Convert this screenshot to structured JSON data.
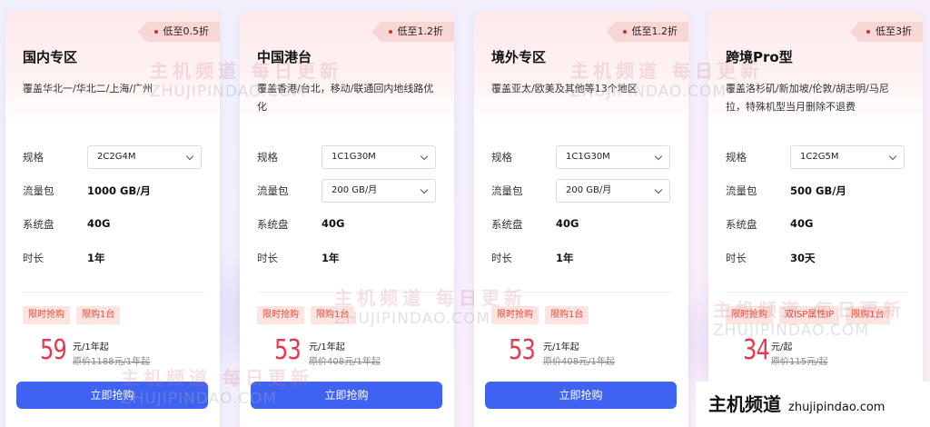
{
  "cards": [
    {
      "discount": "低至0.5折",
      "title": "国内专区",
      "desc": "覆盖华北一/华北二/上海/广州",
      "spec_label": "规格",
      "spec_value": "2C2G4M",
      "traffic_label": "流量包",
      "traffic_value": "1000 GB/月",
      "disk_label": "系统盘",
      "disk_value": "40G",
      "duration_label": "时长",
      "duration_value": "1年",
      "tags": [
        "限时抢购",
        "限购1台"
      ],
      "price": "59",
      "price_unit": "元/1年起",
      "orig_price": "原价1188元/1年起",
      "buy_label": "立即抢购"
    },
    {
      "discount": "低至1.2折",
      "title": "中国港台",
      "desc": "覆盖香港/台北，移动/联通回内地线路优化",
      "spec_label": "规格",
      "spec_value": "1C1G30M",
      "traffic_label": "流量包",
      "traffic_value": "200 GB/月",
      "disk_label": "系统盘",
      "disk_value": "40G",
      "duration_label": "时长",
      "duration_value": "1年",
      "tags": [
        "限时抢购",
        "限购1台"
      ],
      "price": "53",
      "price_unit": "元/1年起",
      "orig_price": "原价408元/1年起",
      "buy_label": "立即抢购"
    },
    {
      "discount": "低至1.2折",
      "title": "境外专区",
      "desc": "覆盖亚太/欧美及其他等13个地区",
      "spec_label": "规格",
      "spec_value": "1C1G30M",
      "traffic_label": "流量包",
      "traffic_value": "200 GB/月",
      "disk_label": "系统盘",
      "disk_value": "40G",
      "duration_label": "时长",
      "duration_value": "1年",
      "tags": [
        "限时抢购",
        "限购1台"
      ],
      "price": "53",
      "price_unit": "元/1年起",
      "orig_price": "原价408元/1年起",
      "buy_label": "立即抢购"
    },
    {
      "discount": "低至3折",
      "title": "跨境Pro型",
      "desc": "覆盖洛杉矶/新加坡/伦敦/胡志明/马尼拉，特殊机型当月删除不退费",
      "spec_label": "规格",
      "spec_value": "1C2G5M",
      "traffic_label": "流量包",
      "traffic_value": "500 GB/月",
      "disk_label": "系统盘",
      "disk_value": "40G",
      "duration_label": "时长",
      "duration_value": "30天",
      "tags": [
        "限时抢购",
        "双ISP属性IP",
        "限购1台"
      ],
      "price": "34",
      "price_unit": "元/起",
      "orig_price": "原价115元/起",
      "buy_label": "立即抢购"
    }
  ],
  "watermark": {
    "cn": "主机频道 每日更新",
    "en": "ZHUJIPINDAO.COM"
  },
  "site_badge": {
    "name": "主机频道",
    "domain": "zhujipindao.com"
  },
  "colors": {
    "accent": "#3f63f0",
    "price": "#e23a4e",
    "tag_bg": "#fde4e1",
    "tag_text": "#e24b3b"
  }
}
